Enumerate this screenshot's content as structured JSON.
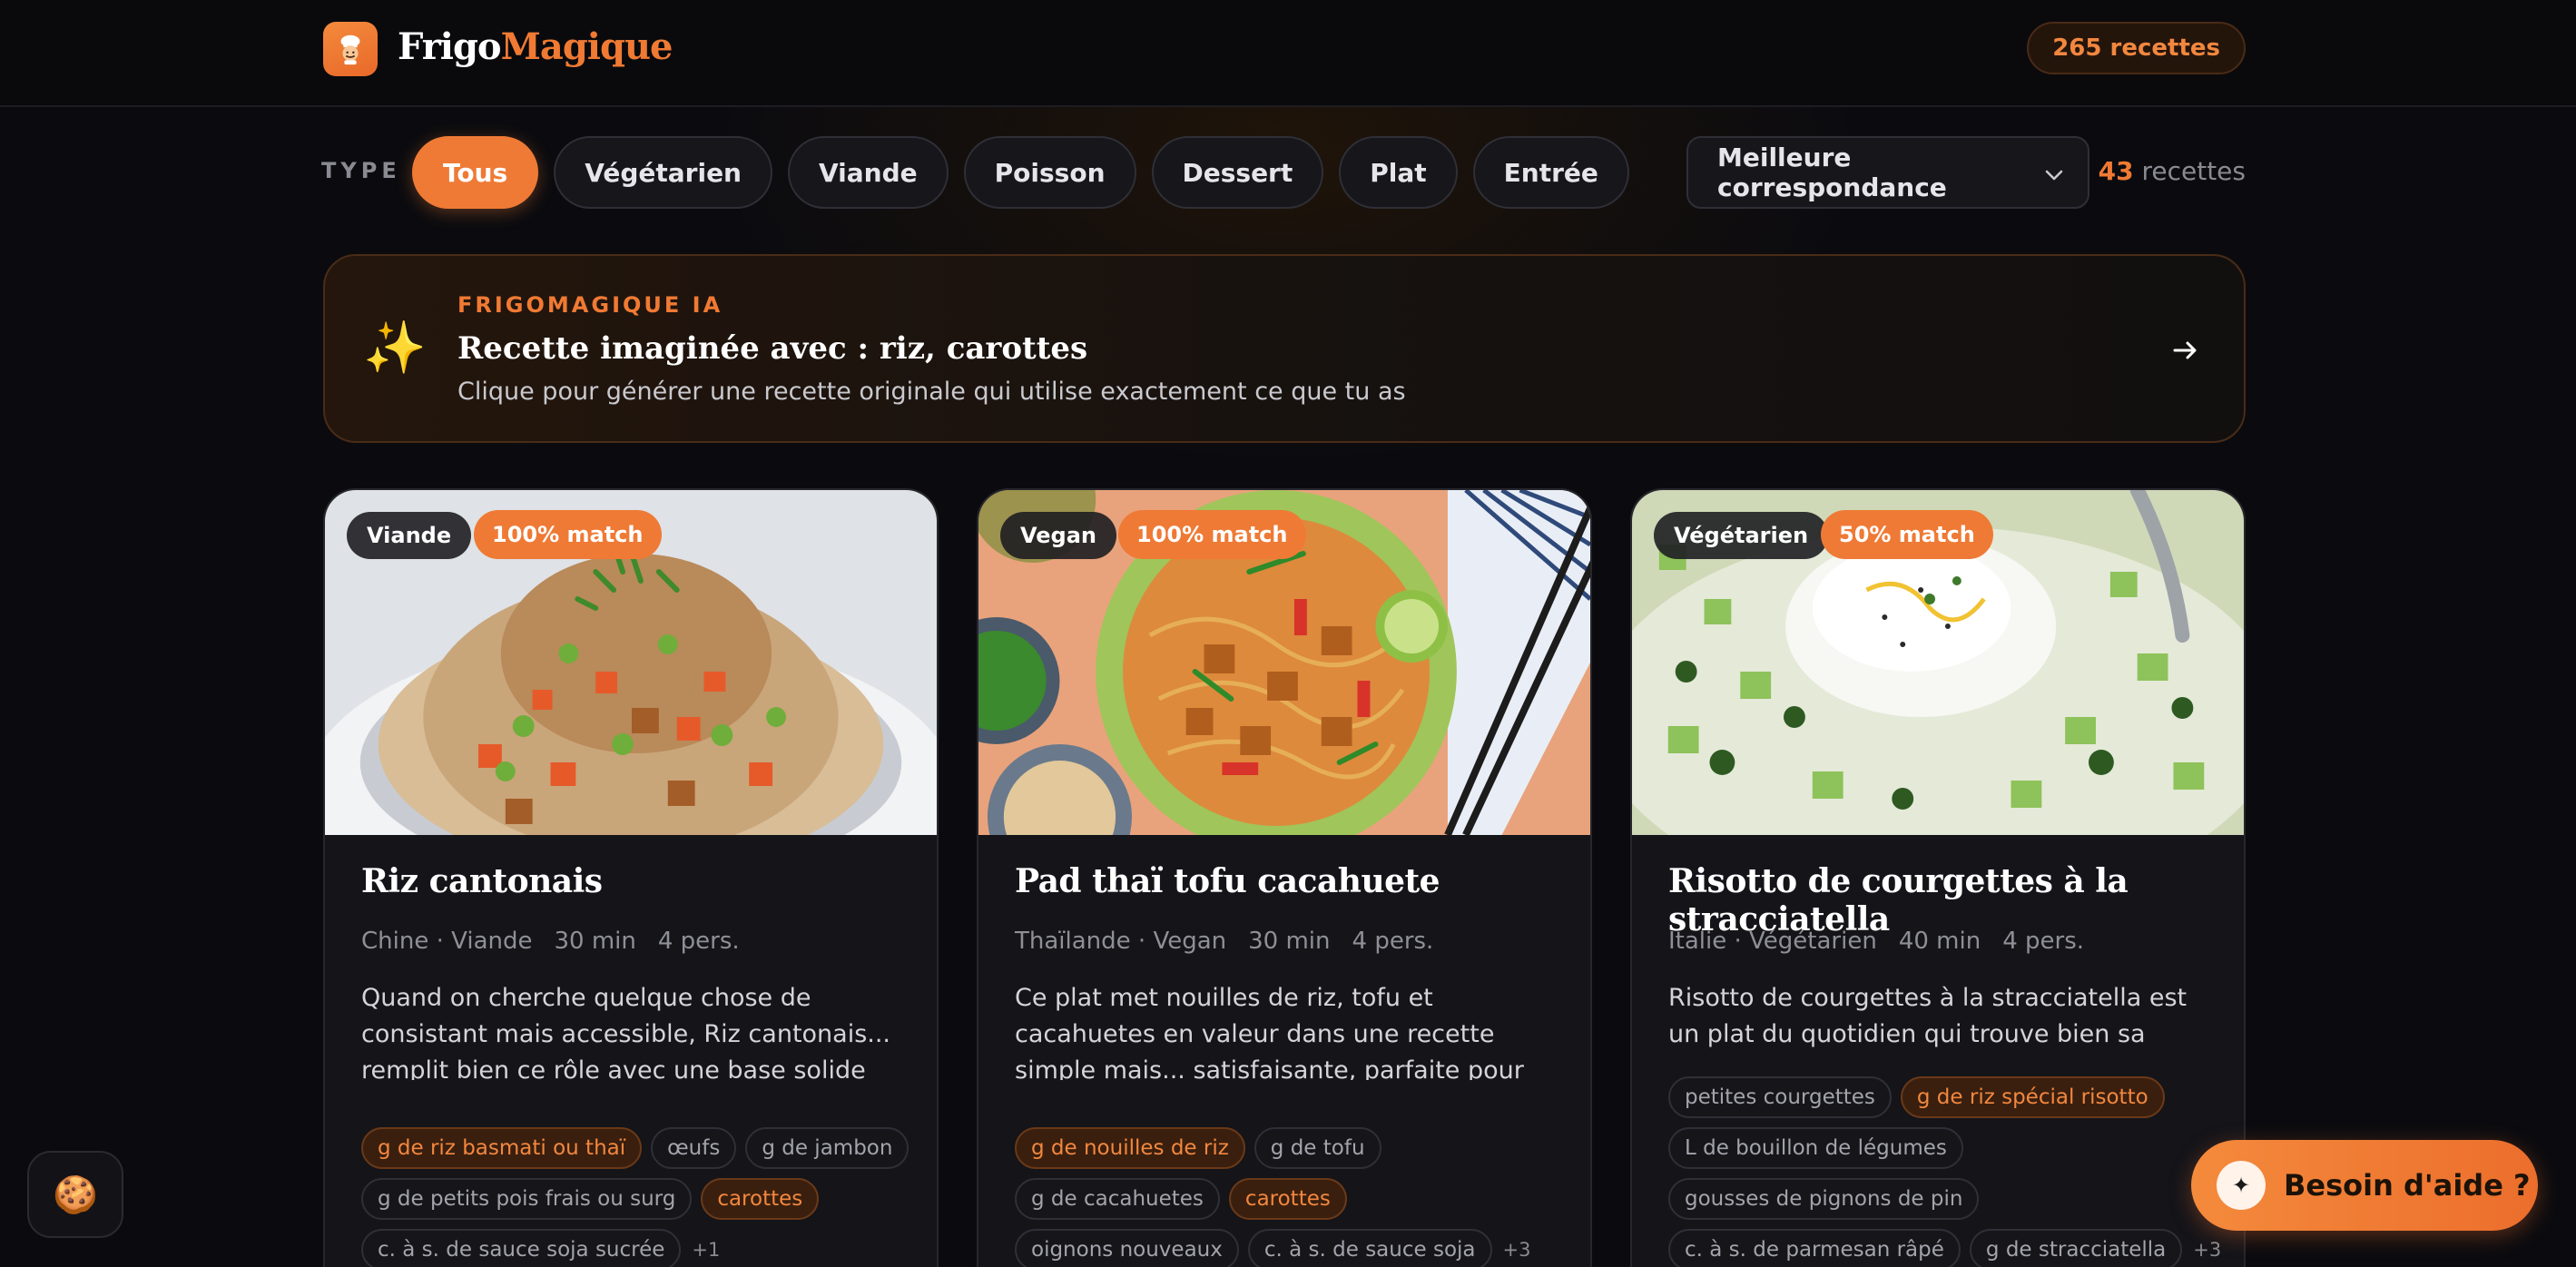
{
  "header": {
    "brand_first": "Frigo",
    "brand_second": "Magique",
    "total_recipes": "265 recettes"
  },
  "filters": {
    "type_label": "TYPE",
    "chips": [
      {
        "label": "Tous",
        "active": true
      },
      {
        "label": "Végétarien",
        "active": false
      },
      {
        "label": "Viande",
        "active": false
      },
      {
        "label": "Poisson",
        "active": false
      },
      {
        "label": "Dessert",
        "active": false
      },
      {
        "label": "Plat",
        "active": false
      },
      {
        "label": "Entrée",
        "active": false
      }
    ],
    "sort_value": "Meilleure correspondance",
    "result_number": "43",
    "result_suffix": "recettes"
  },
  "ai_banner": {
    "kicker": "FRIGOMAGIQUE IA",
    "title": "Recette imaginée avec : riz, carottes",
    "subtitle": "Clique pour générer une recette originale qui utilise exactement ce que tu as"
  },
  "cards": [
    {
      "type": "Viande",
      "match": "100% match",
      "title": "Riz cantonais",
      "origin": "Chine · Viande",
      "time": "30 min",
      "servings": "4 pers.",
      "description": "Quand on cherche quelque chose de consistant mais accessible, Riz cantonais... remplit bien ce rôle avec une base solide autour de riz basmati ou thaï, œufs et jambon.",
      "tags": [
        {
          "label": "g de riz basmati ou thaï",
          "hl": true
        },
        {
          "label": "œufs",
          "hl": false
        },
        {
          "label": "g de jambon",
          "hl": false
        },
        {
          "label": "g de petits pois frais ou surg",
          "hl": false
        },
        {
          "label": "carottes",
          "hl": true
        },
        {
          "label": "c. à s. de sauce soja sucrée",
          "hl": false
        }
      ],
      "more": "+1"
    },
    {
      "type": "Vegan",
      "match": "100% match",
      "title": "Pad thaï tofu cacahuete",
      "origin": "Thaïlande · Vegan",
      "time": "30 min",
      "servings": "4 pers.",
      "description": "Ce plat met nouilles de riz, tofu et cacahuetes en valeur dans une recette simple mais... satisfaisante, parfaite pour une table familiale ou un dîner sans stress.",
      "tags": [
        {
          "label": "g de nouilles de riz",
          "hl": true
        },
        {
          "label": "g de tofu",
          "hl": false
        },
        {
          "label": "g de cacahuetes",
          "hl": false
        },
        {
          "label": "carottes",
          "hl": true
        },
        {
          "label": "oignons nouveaux",
          "hl": false
        },
        {
          "label": "c. à s. de sauce soja",
          "hl": false
        }
      ],
      "more": "+3"
    },
    {
      "type": "Végétarien",
      "match": "50% match",
      "title": "Risotto de courgettes à la stracciatella",
      "origin": "Italie · Végétarien",
      "time": "40 min",
      "servings": "4 pers.",
      "description": "Risotto de courgettes à la stracciatella est un plat du quotidien qui trouve bien sa place...",
      "tags": [
        {
          "label": "petites courgettes",
          "hl": false
        },
        {
          "label": "g de riz spécial risotto",
          "hl": true
        },
        {
          "label": "L de bouillon de légumes",
          "hl": false
        },
        {
          "label": "gousses de pignons de pin",
          "hl": false
        },
        {
          "label": "c. à s. de parmesan râpé",
          "hl": false
        },
        {
          "label": "g de stracciatella",
          "hl": false
        }
      ],
      "more": "+3"
    }
  ],
  "help": {
    "label": "Besoin d'aide ?"
  },
  "colors": {
    "accent": "#ef7a35",
    "background": "#0b0b0f",
    "card": "#141419"
  },
  "icons": {
    "logo": "chef-icon",
    "banner": "sparkles-icon",
    "arrow": "arrow-right-icon",
    "sort": "chevron-down-icon",
    "cookie": "cookie-icon",
    "help": "sparkle-icon"
  }
}
